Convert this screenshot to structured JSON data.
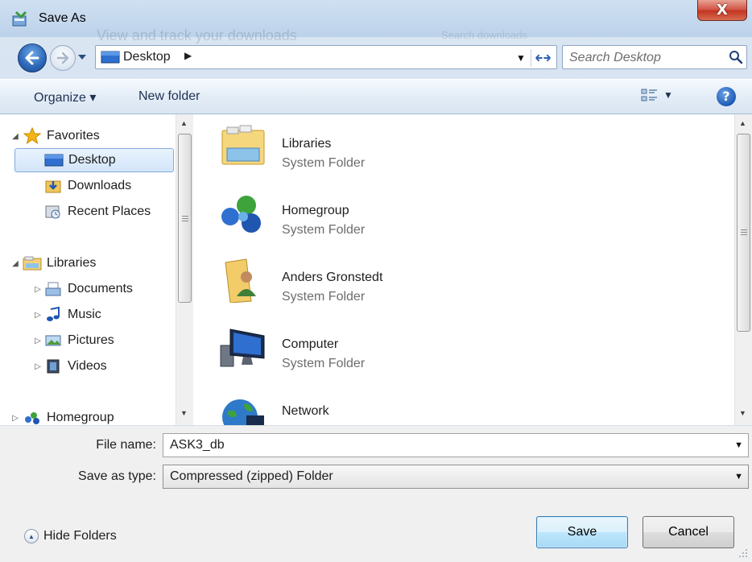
{
  "window": {
    "title": "Save As",
    "background_ghost_text": "View and track your downloads",
    "background_ghost_search": "Search downloads",
    "close_glyph": "X"
  },
  "address": {
    "location": "Desktop",
    "crumb_separator": "▶",
    "dropdown_glyph": "▼",
    "icons": {
      "back": "back-arrow-icon",
      "forward": "forward-arrow-icon",
      "refresh": "refresh-icon",
      "location": "desktop-icon"
    }
  },
  "search": {
    "placeholder": "Search Desktop",
    "icon": "magnifier-icon"
  },
  "toolbar": {
    "organize_label": "Organize ▾",
    "new_folder_label": "New folder",
    "views_arrow": "▼",
    "help_label": "?"
  },
  "navigation": {
    "favorites_label": "Favorites",
    "favorites": [
      "Desktop",
      "Downloads",
      "Recent Places"
    ],
    "libraries_label": "Libraries",
    "libraries": [
      "Documents",
      "Music",
      "Pictures",
      "Videos"
    ],
    "homegroup_label": "Homegroup",
    "expanded_glyph": "◢",
    "collapsed_glyph": "▷",
    "selected": "Desktop"
  },
  "content": {
    "items": [
      {
        "name": "Libraries",
        "type": "System Folder",
        "icon": "libraries-folder-icon"
      },
      {
        "name": "Homegroup",
        "type": "System Folder",
        "icon": "homegroup-icon"
      },
      {
        "name": "Anders Gronstedt",
        "type": "System Folder",
        "icon": "user-folder-icon"
      },
      {
        "name": "Computer",
        "type": "System Folder",
        "icon": "computer-icon"
      },
      {
        "name": "Network",
        "type": "",
        "icon": "network-icon"
      }
    ]
  },
  "form": {
    "file_name_label": "File name:",
    "file_name_value": "ASK3_db",
    "save_type_label": "Save as type:",
    "save_type_value": "Compressed (zipped) Folder",
    "hide_folders_label": "Hide Folders",
    "save_label": "Save",
    "cancel_label": "Cancel"
  },
  "colors": {
    "chrome": "#c9d9ec",
    "selection": "#d2e5fa",
    "close_button": "#c23522",
    "secondary_text": "#6d6d6d"
  }
}
